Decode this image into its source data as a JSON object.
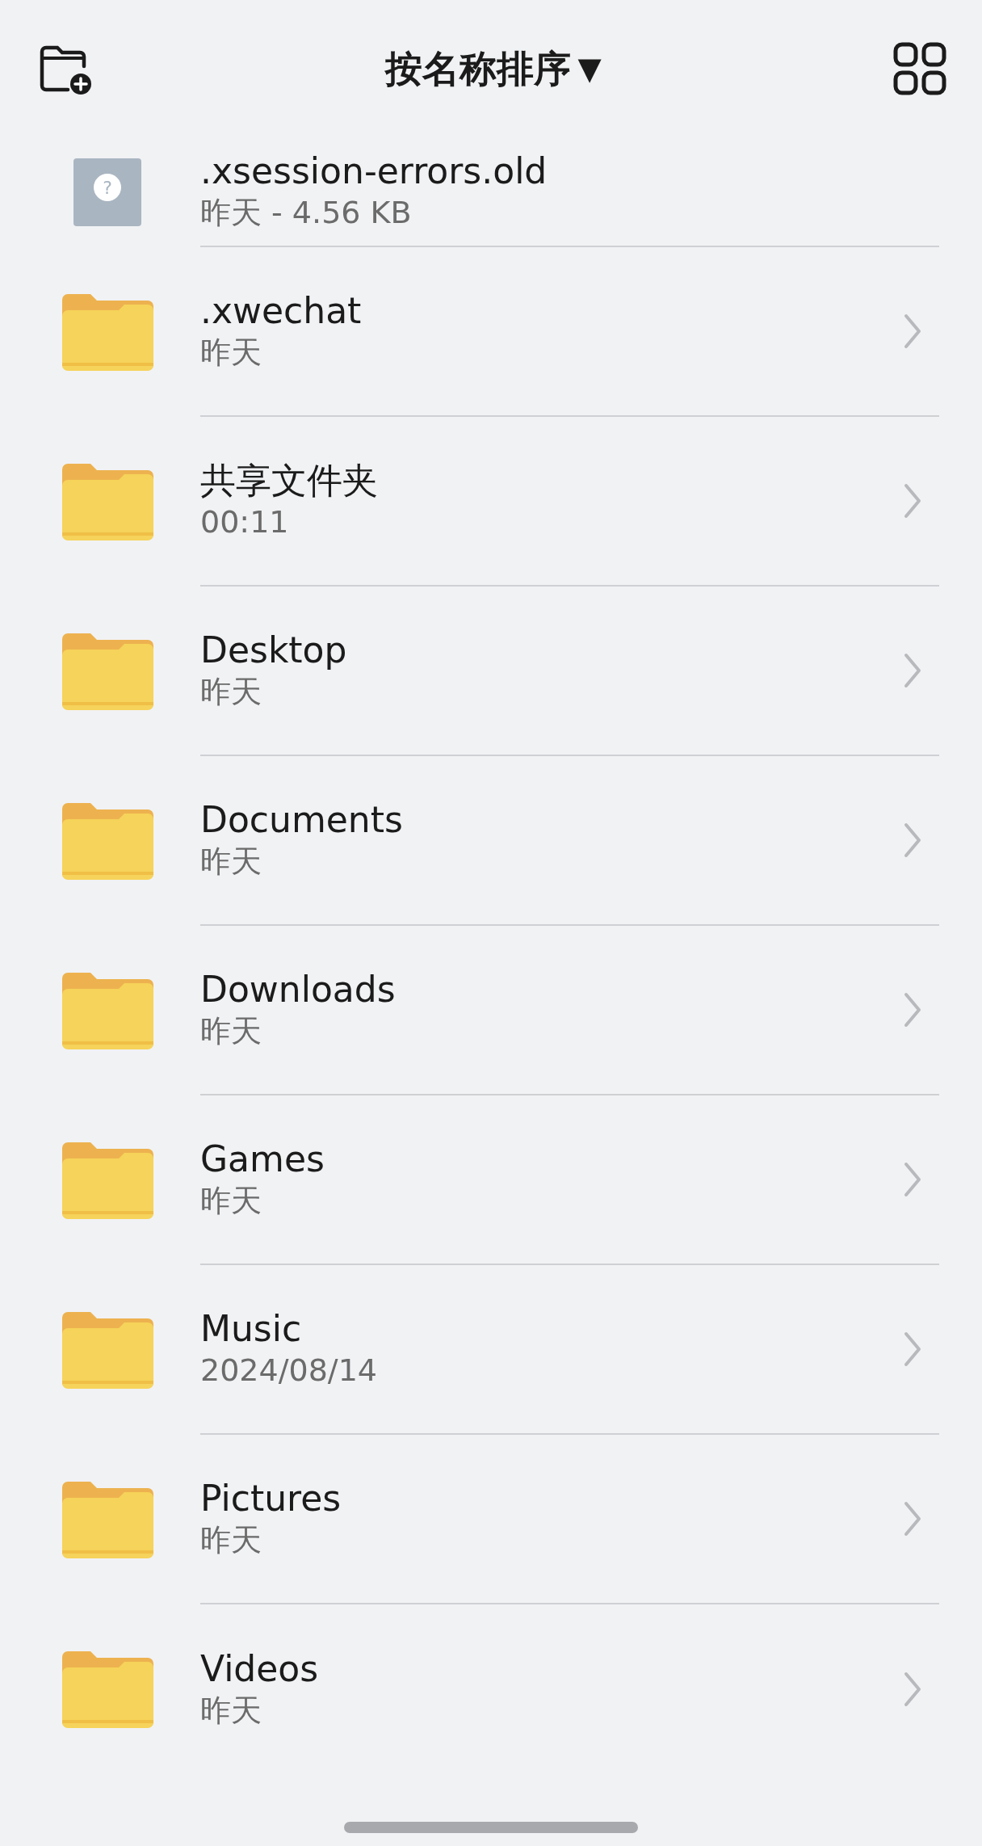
{
  "header": {
    "sort_label": "按名称排序",
    "sort_caret": "▼"
  },
  "files": [
    {
      "kind": "file",
      "name": ".xsession-errors.old",
      "meta": "昨天 - 4.56 KB",
      "icon_glyph": "?"
    },
    {
      "kind": "folder",
      "name": ".xwechat",
      "meta": "昨天"
    },
    {
      "kind": "folder",
      "name": "共享文件夹",
      "meta": "00:11"
    },
    {
      "kind": "folder",
      "name": "Desktop",
      "meta": "昨天"
    },
    {
      "kind": "folder",
      "name": "Documents",
      "meta": "昨天"
    },
    {
      "kind": "folder",
      "name": "Downloads",
      "meta": "昨天"
    },
    {
      "kind": "folder",
      "name": "Games",
      "meta": "昨天"
    },
    {
      "kind": "folder",
      "name": "Music",
      "meta": "2024/08/14"
    },
    {
      "kind": "folder",
      "name": "Pictures",
      "meta": "昨天"
    },
    {
      "kind": "folder",
      "name": "Videos",
      "meta": "昨天"
    }
  ]
}
